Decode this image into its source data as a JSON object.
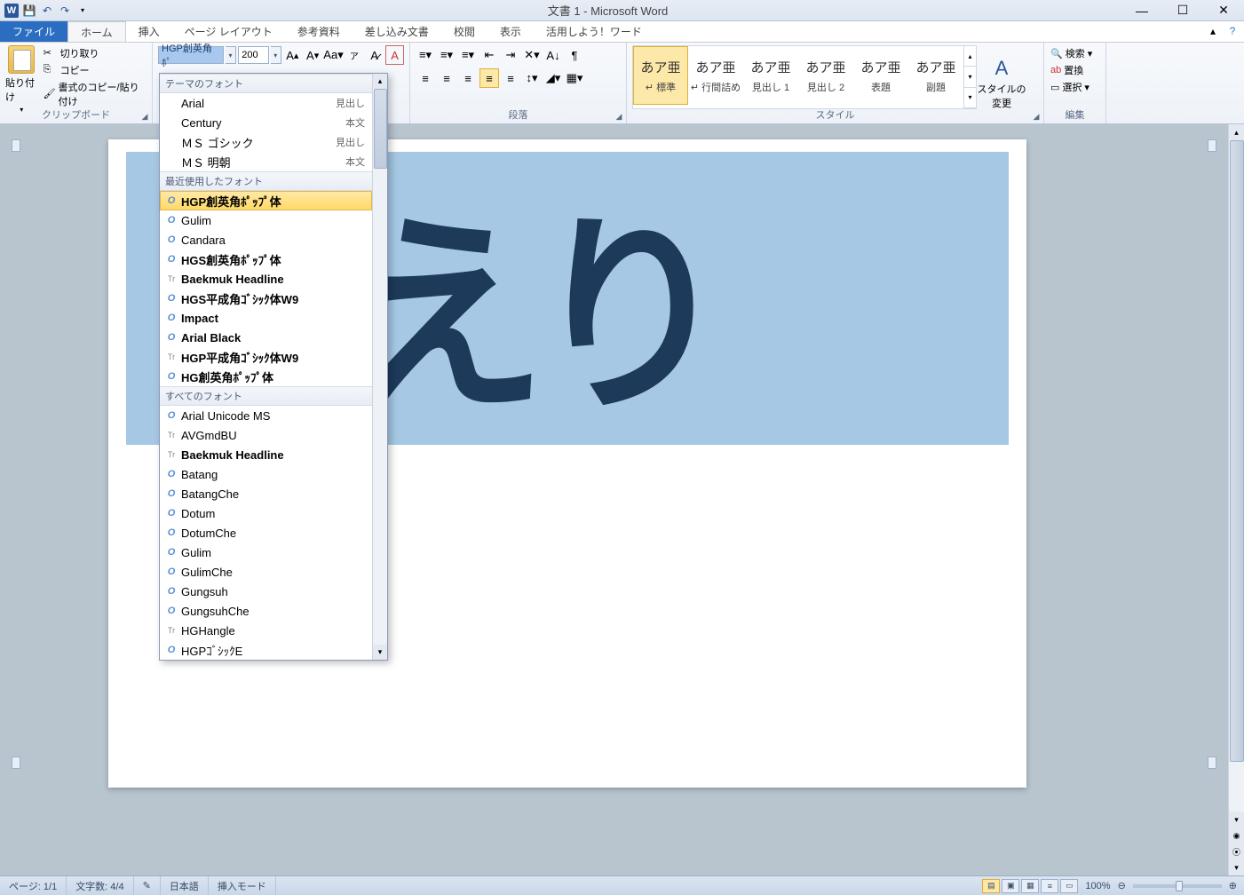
{
  "window": {
    "title": "文書 1 - Microsoft Word"
  },
  "tabs": {
    "file": "ファイル",
    "home": "ホーム",
    "insert": "挿入",
    "layout": "ページ レイアウト",
    "references": "参考資料",
    "mailings": "差し込み文書",
    "review": "校閲",
    "view": "表示",
    "use": "活用しよう！ワード"
  },
  "clipboard": {
    "group": "クリップボード",
    "paste": "貼り付け",
    "cut": "切り取り",
    "copy": "コピー",
    "format": "書式のコピー/貼り付け"
  },
  "font": {
    "combo": "HGP創英角ﾎﾟ",
    "size": "200"
  },
  "paragraph": {
    "group": "段落"
  },
  "styles": {
    "group": "スタイル",
    "change": "スタイルの\n変更",
    "items": [
      {
        "preview": "あア亜",
        "name": "↵ 標準",
        "active": true
      },
      {
        "preview": "あア亜",
        "name": "↵ 行間詰め"
      },
      {
        "preview": "あア亜",
        "name": "見出し 1"
      },
      {
        "preview": "あア亜",
        "name": "見出し 2"
      },
      {
        "preview": "あア亜",
        "name": "表題"
      },
      {
        "preview": "あア亜",
        "name": "副題"
      }
    ]
  },
  "edit": {
    "group": "編集",
    "find": "検索",
    "replace": "置換",
    "select": "選択"
  },
  "dropdown": {
    "section_theme": "テーマのフォント",
    "theme": [
      {
        "name": "Arial",
        "tag": "見出し",
        "type": "none"
      },
      {
        "name": "Century",
        "tag": "本文",
        "type": "none"
      },
      {
        "name": "ＭＳ ゴシック",
        "tag": "見出し",
        "type": "none"
      },
      {
        "name": "ＭＳ 明朝",
        "tag": "本文",
        "type": "none"
      }
    ],
    "section_recent": "最近使用したフォント",
    "recent": [
      {
        "name": "HGP創英角ﾎﾟｯﾌﾟ体",
        "type": "O",
        "hl": true,
        "bold": true
      },
      {
        "name": "Gulim",
        "type": "O"
      },
      {
        "name": "Candara",
        "type": "O"
      },
      {
        "name": "HGS創英角ﾎﾟｯﾌﾟ体",
        "type": "O",
        "bold": true
      },
      {
        "name": "Baekmuk Headline",
        "type": "T",
        "bold": true
      },
      {
        "name": "HGS平成角ｺﾞｼｯｸ体W9",
        "type": "O",
        "bold": true
      },
      {
        "name": "Impact",
        "type": "O",
        "bold": true
      },
      {
        "name": "Arial Black",
        "type": "O",
        "bold": true
      },
      {
        "name": "HGP平成角ｺﾞｼｯｸ体W9",
        "type": "T",
        "bold": true
      },
      {
        "name": "HG創英角ﾎﾟｯﾌﾟ体",
        "type": "O",
        "bold": true
      }
    ],
    "section_all": "すべてのフォント",
    "all": [
      {
        "name": "Arial Unicode MS",
        "type": "O"
      },
      {
        "name": "AVGmdBU",
        "type": "T"
      },
      {
        "name": "Baekmuk Headline",
        "type": "T",
        "bold": true
      },
      {
        "name": "Batang",
        "type": "O"
      },
      {
        "name": "BatangChe",
        "type": "O"
      },
      {
        "name": "Dotum",
        "type": "O"
      },
      {
        "name": "DotumChe",
        "type": "O"
      },
      {
        "name": "Gulim",
        "type": "O"
      },
      {
        "name": "GulimChe",
        "type": "O"
      },
      {
        "name": "Gungsuh",
        "type": "O"
      },
      {
        "name": "GungsuhChe",
        "type": "O"
      },
      {
        "name": "HGHangle",
        "type": "T"
      },
      {
        "name": "HGPｺﾞｼｯｸE",
        "type": "O"
      }
    ]
  },
  "document": {
    "text": "かえり"
  },
  "status": {
    "page": "ページ: 1/1",
    "words": "文字数: 4/4",
    "lang": "日本語",
    "mode": "挿入モード",
    "zoom": "100%"
  }
}
